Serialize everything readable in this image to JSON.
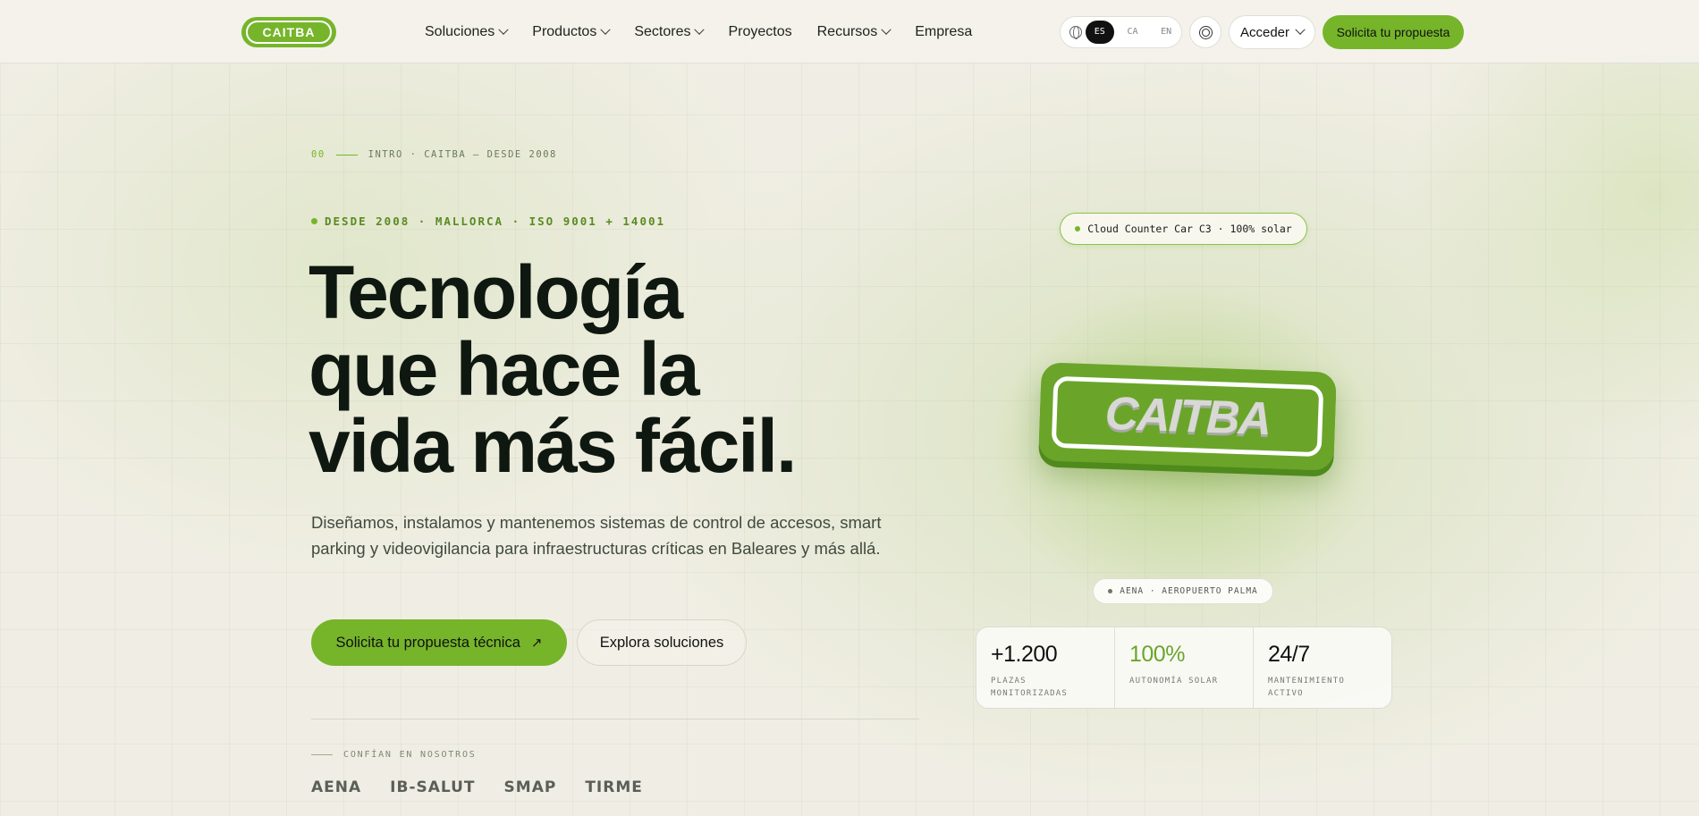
{
  "nav": {
    "logo_text": "CAITBA",
    "menu": [
      {
        "label": "Soluciones",
        "has_dropdown": true
      },
      {
        "label": "Productos",
        "has_dropdown": true
      },
      {
        "label": "Sectores",
        "has_dropdown": true
      },
      {
        "label": "Proyectos",
        "has_dropdown": false
      },
      {
        "label": "Recursos",
        "has_dropdown": true
      },
      {
        "label": "Empresa",
        "has_dropdown": false
      }
    ],
    "languages": [
      "ES",
      "CA",
      "EN"
    ],
    "active_language": "ES",
    "login_label": "Acceder",
    "cta_label": "Solicita tu propuesta"
  },
  "hero": {
    "eyebrow_num": "00",
    "eyebrow_text": "INTRO · CAITBA — DESDE 2008",
    "badge_text": "DESDE 2008 · MALLORCA · ISO 9001 + 14001",
    "headline_lines": [
      "Tecnología",
      "que hace la",
      "vida más fácil."
    ],
    "subtitle": "Diseñamos, instalamos y mantenemos sistemas de control de accesos, smart parking y videovigilancia para infraestructuras críticas en Baleares y más allá.",
    "primary_button": "Solicita tu propuesta técnica",
    "secondary_button": "Explora soluciones",
    "trust_label": "CONFÍAN EN NOSOTROS",
    "trust_logos": [
      "AENA",
      "IB-SALUT",
      "SMAP",
      "TIRME"
    ]
  },
  "showcase": {
    "top_pill": "Cloud Counter Car C3 · 100% solar",
    "logo_text": "CAITBA",
    "location_pill": "AENA · AEROPUERTO PALMA",
    "stats": [
      {
        "value": "+1.200",
        "label": "PLAZAS MONITORIZADAS",
        "accent": false
      },
      {
        "value": "100%",
        "label": "AUTONOMÍA SOLAR",
        "accent": true
      },
      {
        "value": "24/7",
        "label": "MANTENIMIENTO ACTIVO",
        "accent": false
      }
    ]
  },
  "colors": {
    "accent": "#76b52a",
    "text": "#0f1810",
    "background": "#f0eee4"
  }
}
